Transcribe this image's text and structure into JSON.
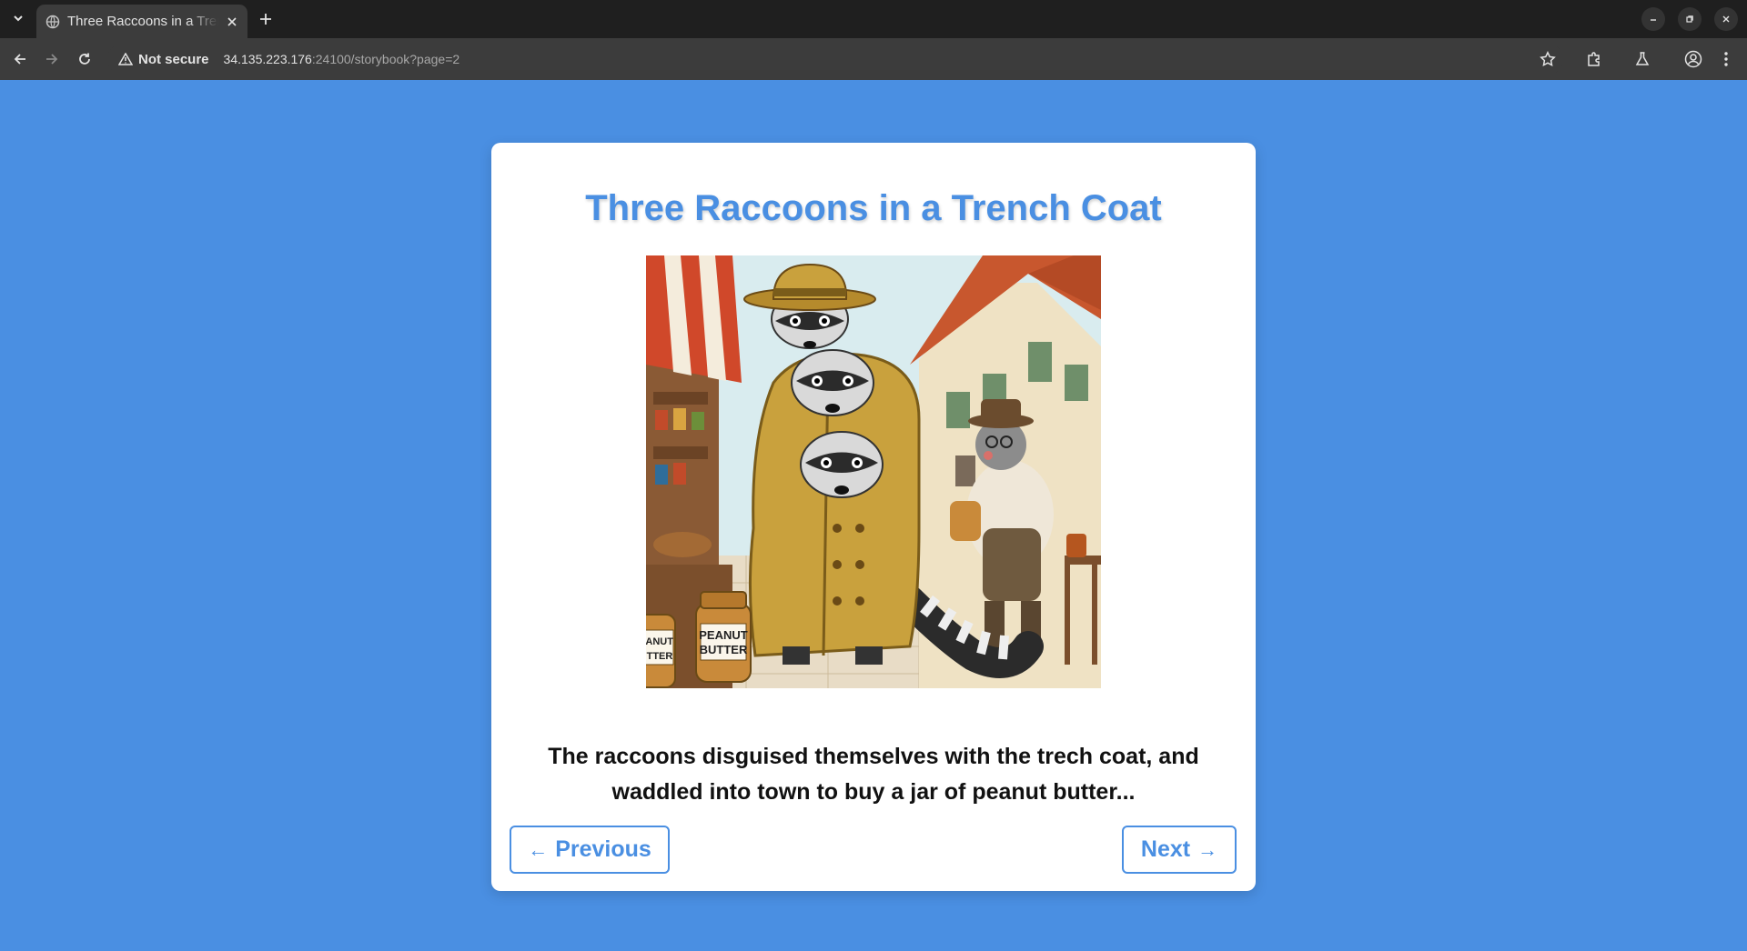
{
  "browser": {
    "tab_title": "Three Raccoons in a Trench Coat",
    "security_label": "Not secure",
    "url_host": "34.135.223.176",
    "url_rest": ":24100/storybook?page=2"
  },
  "story": {
    "title": "Three Raccoons in a Trench Coat",
    "text": "The raccoons disguised themselves with the trech coat, and waddled into town to buy a jar of peanut butter...",
    "jar_label_line1": "PEANUT",
    "jar_label_line2": "BUTTER",
    "jar2_label_line1": "EANUT",
    "jar2_label_line2": "UTTER"
  },
  "navigation": {
    "previous_arrow": "←",
    "previous_label": "Previous",
    "next_label": "Next",
    "next_arrow": "→"
  },
  "colors": {
    "page_background": "#4a8fe2",
    "accent": "#4a8fe2"
  }
}
